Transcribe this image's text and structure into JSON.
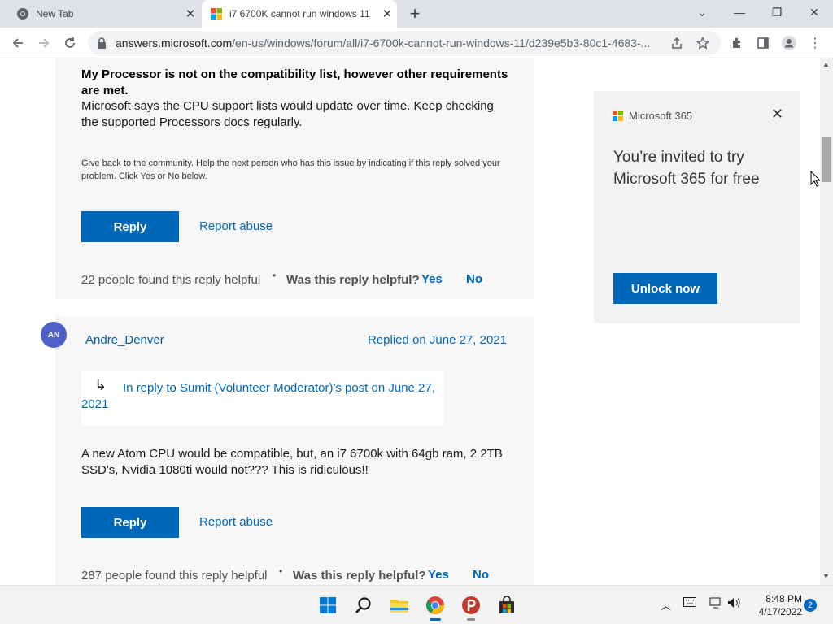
{
  "browser": {
    "tabs": [
      {
        "title": "New Tab",
        "active": false
      },
      {
        "title": "i7 6700K cannot run windows 11",
        "active": true
      }
    ],
    "url_host": "answers.microsoft.com",
    "url_path": "/en-us/windows/forum/all/i7-6700k-cannot-run-windows-11/d239e5b3-80c1-4683-..."
  },
  "reply1": {
    "heading": "My Processor is not on the compatibility list, however other requirements are met.",
    "body": "Microsoft says the CPU support lists would update over time. Keep checking the supported Processors docs regularly.",
    "community_note": "Give back to the community. Help the next person who has this issue by indicating if this reply solved your problem. Click Yes or No below.",
    "reply_label": "Reply",
    "report_label": "Report abuse",
    "helpful_count": "22 people found this reply helpful",
    "helpful_question": "Was this reply helpful?",
    "yes": "Yes",
    "no": "No"
  },
  "reply2": {
    "avatar_initials": "AN",
    "author": "Andre_Denver",
    "replied_on": "Replied on June 27, 2021",
    "in_reply_to": "In reply to Sumit (Volunteer Moderator)'s post on June 27, 2021",
    "body": "A new Atom CPU would be compatible, but, an i7 6700k with 64gb ram, 2 2TB SSD's, Nvidia 1080ti would not??? This is ridiculous!!",
    "reply_label": "Reply",
    "report_label": "Report abuse",
    "helpful_count": "287 people found this reply helpful",
    "helpful_question": "Was this reply helpful?",
    "yes": "Yes",
    "no": "No"
  },
  "ad": {
    "brand": "Microsoft 365",
    "headline": "You’re invited to try Microsoft 365 for free",
    "cta": "Unlock now"
  },
  "taskbar": {
    "time": "8:48 PM",
    "date": "4/17/2022",
    "notifications": "2"
  },
  "colors": {
    "accent": "#0067b8",
    "card_bg": "#f7f7f7",
    "avatar": "#4e5fc7"
  }
}
